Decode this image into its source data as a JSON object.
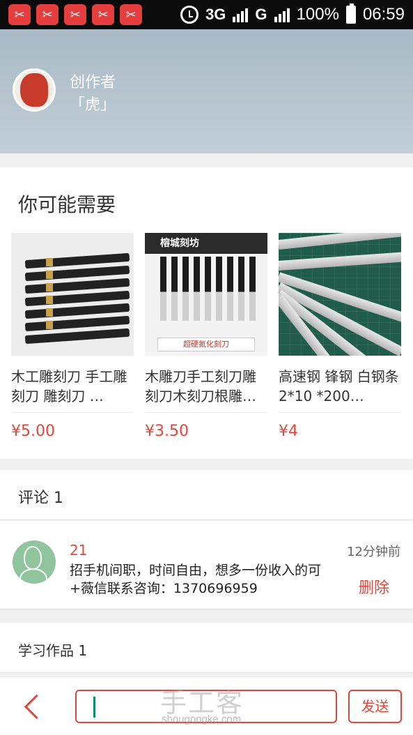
{
  "status_bar": {
    "notification_count": 5,
    "network_1": "3G",
    "network_2": "G",
    "battery": "100%",
    "time": "06:59",
    "notification_icon": "scissors-app-icon"
  },
  "profile": {
    "creator_label": "创作者",
    "creator_name": "「虎」",
    "avatar_icon": "tiger-avatar"
  },
  "recommend": {
    "title": "你可能需要",
    "products": [
      {
        "name": "木工雕刻刀 手工雕刻刀 雕刻刀 …",
        "price": "¥5.00"
      },
      {
        "name": "木雕刀手工刻刀雕刻刀木刻刀根雕…",
        "price": "¥3.50",
        "image_brand": "榕城刻坊",
        "image_label": "超硬氮化刻刀"
      },
      {
        "name": "高速钢 锋钢 白钢条 2*10 *200…",
        "price": "¥4"
      }
    ]
  },
  "comments": {
    "title": "评论 1",
    "items": [
      {
        "user": "21",
        "time": "12分钟前",
        "text": "招手机间职，时间自由，想多一份收入的可+薇信联系咨询：1370696959",
        "delete_label": "删除"
      }
    ]
  },
  "works": {
    "title": "学习作品 1"
  },
  "bottom_bar": {
    "send_label": "发送",
    "input_value": "",
    "watermark": "手工客",
    "watermark_url": "shougongke.com"
  },
  "colors": {
    "accent": "#e0473b",
    "cursor": "#0d8a72"
  }
}
